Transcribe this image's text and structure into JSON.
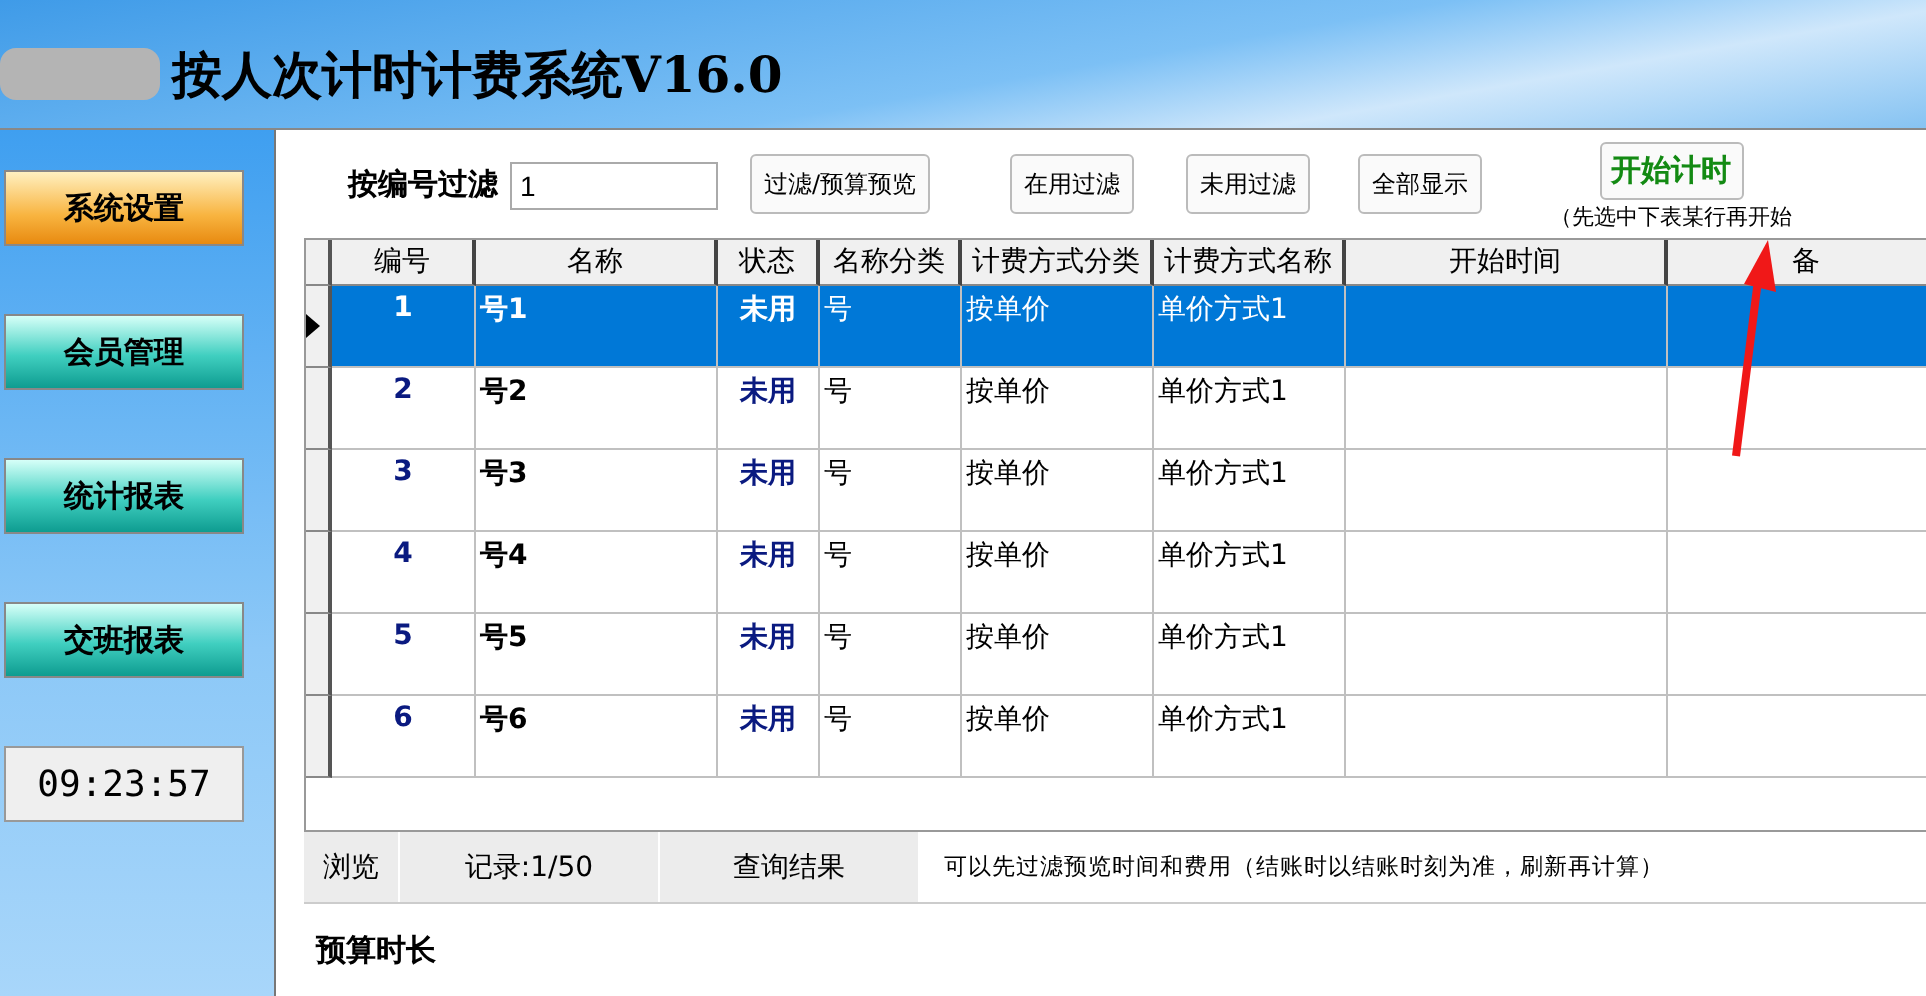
{
  "window": {
    "title": "按人次计时计费系统V16.0"
  },
  "sidebar": {
    "items": [
      {
        "label": "系统设置",
        "selected": true
      },
      {
        "label": "会员管理",
        "selected": false
      },
      {
        "label": "统计报表",
        "selected": false
      },
      {
        "label": "交班报表",
        "selected": false
      }
    ],
    "clock": "09:23:57"
  },
  "filter": {
    "label": "按编号过滤",
    "value": "1",
    "buttons": [
      "过滤/预算预览",
      "在用过滤",
      "未用过滤",
      "全部显示"
    ],
    "start_button": "开始计时",
    "hint": "（先选中下表某行再开始"
  },
  "table": {
    "columns": [
      "编号",
      "名称",
      "状态",
      "名称分类",
      "计费方式分类",
      "计费方式名称",
      "开始时间",
      "备"
    ],
    "rows": [
      {
        "cells": [
          "1",
          "号1",
          "未用",
          "号",
          "按单价",
          "单价方式1",
          "",
          ""
        ],
        "selected": true
      },
      {
        "cells": [
          "2",
          "号2",
          "未用",
          "号",
          "按单价",
          "单价方式1",
          "",
          ""
        ],
        "selected": false
      },
      {
        "cells": [
          "3",
          "号3",
          "未用",
          "号",
          "按单价",
          "单价方式1",
          "",
          ""
        ],
        "selected": false
      },
      {
        "cells": [
          "4",
          "号4",
          "未用",
          "号",
          "按单价",
          "单价方式1",
          "",
          ""
        ],
        "selected": false
      },
      {
        "cells": [
          "5",
          "号5",
          "未用",
          "号",
          "按单价",
          "单价方式1",
          "",
          ""
        ],
        "selected": false
      },
      {
        "cells": [
          "6",
          "号6",
          "未用",
          "号",
          "按单价",
          "单价方式1",
          "",
          ""
        ],
        "selected": false
      }
    ]
  },
  "status_bar": {
    "browse": "浏览",
    "records": "记录:1/50",
    "query": "查询结果",
    "note": "可以先过滤预览时间和费用（结账时以结账时刻为准，刷新再计算）"
  },
  "footer": {
    "label": "预算时长"
  }
}
